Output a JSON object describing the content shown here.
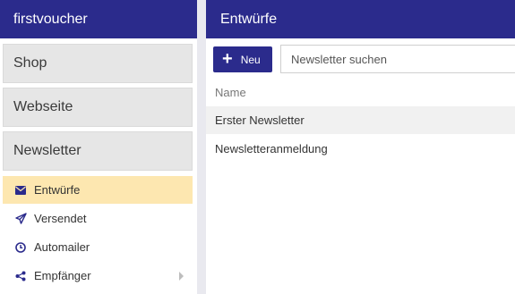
{
  "sidebar": {
    "brand": "firstvoucher",
    "sections": {
      "shop": "Shop",
      "website": "Webseite",
      "newsletter": "Newsletter"
    },
    "subitems": [
      {
        "label": "Entwürfe",
        "icon": "envelope-icon"
      },
      {
        "label": "Versendet",
        "icon": "paper-plane-icon"
      },
      {
        "label": "Automailer",
        "icon": "clock-icon"
      },
      {
        "label": "Empfänger",
        "icon": "share-icon"
      }
    ],
    "active": "Entwürfe"
  },
  "main": {
    "title": "Entwürfe",
    "new_label": "Neu",
    "search_placeholder": "Newsletter suchen",
    "column_name": "Name",
    "rows": [
      "Erster Newsletter",
      "Newsletteranmeldung"
    ]
  },
  "colors": {
    "accent": "#2b2b8c",
    "active_bg": "#fde7b0"
  }
}
